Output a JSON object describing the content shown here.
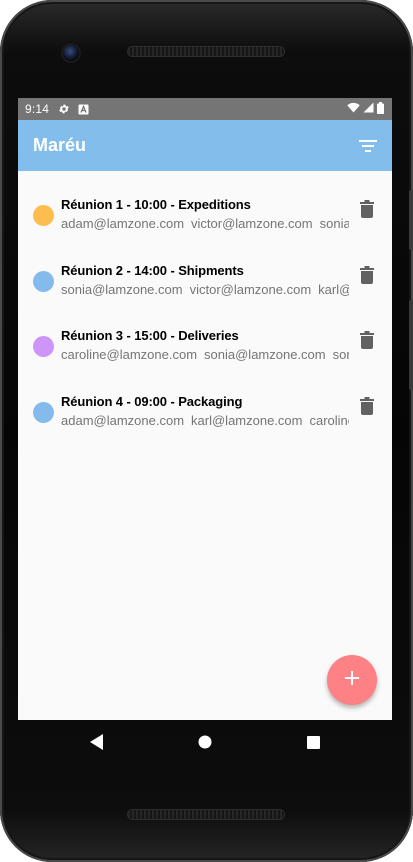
{
  "status_bar": {
    "time": "9:14",
    "icons": [
      "gear-icon",
      "a-badge-icon",
      "wifi-icon",
      "signal-icon",
      "battery-icon"
    ]
  },
  "app_bar": {
    "title": "Maréu",
    "filter_icon": "filter-icon"
  },
  "meetings": [
    {
      "subject": "Réunion 1 - 10:00 - Expeditions",
      "emails": [
        "adam@lamzone.com",
        "victor@lamzone.com",
        "sonia@lamzone.com"
      ],
      "color": "#fdbd4f"
    },
    {
      "subject": "Réunion 2 - 14:00 - Shipments",
      "emails": [
        "sonia@lamzone.com",
        "victor@lamzone.com",
        "karl@lamzone.com"
      ],
      "color": "#84bbec"
    },
    {
      "subject": "Réunion 3 - 15:00 - Deliveries",
      "emails": [
        "caroline@lamzone.com",
        "sonia@lamzone.com",
        "sonia@lamzone.com"
      ],
      "color": "#cf94f7"
    },
    {
      "subject": "Réunion 4 - 09:00 - Packaging",
      "emails": [
        "adam@lamzone.com",
        "karl@lamzone.com",
        "caroline@lamzone.com"
      ],
      "color": "#84bbec"
    }
  ],
  "fab": {
    "label": "+",
    "color": "#fd8185"
  },
  "nav_bar": {
    "icons": [
      "back-icon",
      "home-icon",
      "recents-icon"
    ]
  },
  "colors": {
    "app_bar": "#82bdec",
    "status_bar": "#757575",
    "delete_icon": "#616161"
  }
}
